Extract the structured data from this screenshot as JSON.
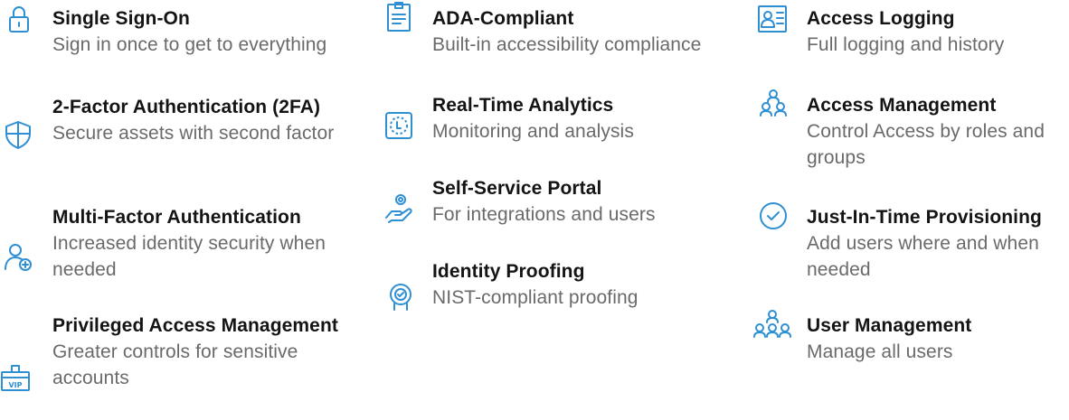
{
  "accent_color": "#2e8fd3",
  "features": [
    {
      "icon": "lock-icon",
      "title": "Single Sign-On",
      "desc": "Sign in once to get to everything"
    },
    {
      "icon": "shield-icon",
      "title": "2-Factor Authentication (2FA)",
      "desc": "Secure assets with second factor"
    },
    {
      "icon": "user-add-icon",
      "title": "Multi-Factor Authentication",
      "desc": "Increased identity security when needed"
    },
    {
      "icon": "vip-badge-icon",
      "title": "Privileged Access Management",
      "desc": "Greater controls for sensitive accounts"
    },
    {
      "icon": "document-icon",
      "title": "ADA-Compliant",
      "desc": "Built-in accessibility compliance"
    },
    {
      "icon": "analytics-icon",
      "title": "Real-Time Analytics",
      "desc": "Monitoring and analysis"
    },
    {
      "icon": "hand-user-icon",
      "title": "Self-Service Portal",
      "desc": "For integrations and users"
    },
    {
      "icon": "identity-proofing-icon",
      "title": "Identity Proofing",
      "desc": "NIST-compliant proofing"
    },
    {
      "icon": "id-card-icon",
      "title": "Access Logging",
      "desc": "Full logging and history"
    },
    {
      "icon": "group-icon",
      "title": "Access Management",
      "desc": "Control Access by roles and groups"
    },
    {
      "icon": "check-circle-icon",
      "title": "Just-In-Time Provisioning",
      "desc": "Add users where and when needed"
    },
    {
      "icon": "users-icon",
      "title": "User Management",
      "desc": "Manage all users"
    }
  ]
}
